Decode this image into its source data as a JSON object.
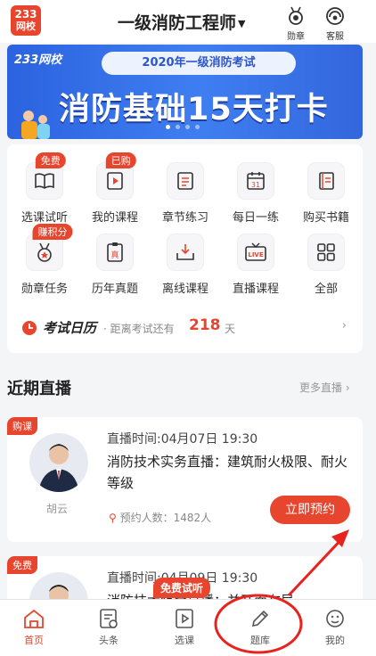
{
  "header": {
    "logo_top": "233",
    "logo_bottom": "网校",
    "title": "一级消防工程师",
    "medal_label": "勋章",
    "service_label": "客服"
  },
  "banner": {
    "brand": "233网校",
    "exam_title": "2020年一级消防考试",
    "headline": "消防基础15天打卡"
  },
  "grid": [
    {
      "label": "选课试听",
      "tag": "免费",
      "icon": "book-open-icon"
    },
    {
      "label": "我的课程",
      "tag": "已购",
      "icon": "video-play-icon"
    },
    {
      "label": "章节练习",
      "tag": "",
      "icon": "list-doc-icon"
    },
    {
      "label": "每日一练",
      "tag": "",
      "icon": "calendar-31-icon",
      "icon_text": "31"
    },
    {
      "label": "购买书籍",
      "tag": "",
      "icon": "book-stack-icon"
    },
    {
      "label": "勋章任务",
      "tag": "赚积分",
      "icon": "medal-icon"
    },
    {
      "label": "历年真题",
      "tag": "",
      "icon": "exam-paper-icon",
      "icon_text": "真"
    },
    {
      "label": "离线课程",
      "tag": "",
      "icon": "download-tray-icon"
    },
    {
      "label": "直播课程",
      "tag": "",
      "icon": "tv-live-icon",
      "icon_text": "LIVE"
    },
    {
      "label": "全部",
      "tag": "",
      "icon": "grid-all-icon"
    }
  ],
  "calendar": {
    "title": "考试日历",
    "subtitle": "· 距离考试还有",
    "days": "218",
    "unit": "天"
  },
  "section": {
    "title": "近期直播",
    "more": "更多直播 ›"
  },
  "lives": [
    {
      "badge": "购课",
      "teacher": "胡云",
      "time": "直播时间:04月07日 19:30",
      "title": "消防技术实务直播：建筑耐火极限、耐火等级",
      "count": "预约人数：1482人",
      "action": "立即预约"
    },
    {
      "badge": "免费",
      "teacher": "",
      "time": "直播时间:04月09日 19:30",
      "title": "消防技术综合直播：并开面布局",
      "count": "",
      "action": ""
    }
  ],
  "free_trial": "免费试听",
  "tabs": [
    {
      "label": "首页",
      "icon": "home-icon",
      "active": true
    },
    {
      "label": "头条",
      "icon": "news-icon",
      "active": false
    },
    {
      "label": "选课",
      "icon": "course-icon",
      "active": false
    },
    {
      "label": "题库",
      "icon": "pencil-icon",
      "active": false
    },
    {
      "label": "我的",
      "icon": "profile-icon",
      "active": false
    }
  ],
  "colors": {
    "accent": "#e8452e",
    "banner_blue": "#3f7ef0"
  }
}
